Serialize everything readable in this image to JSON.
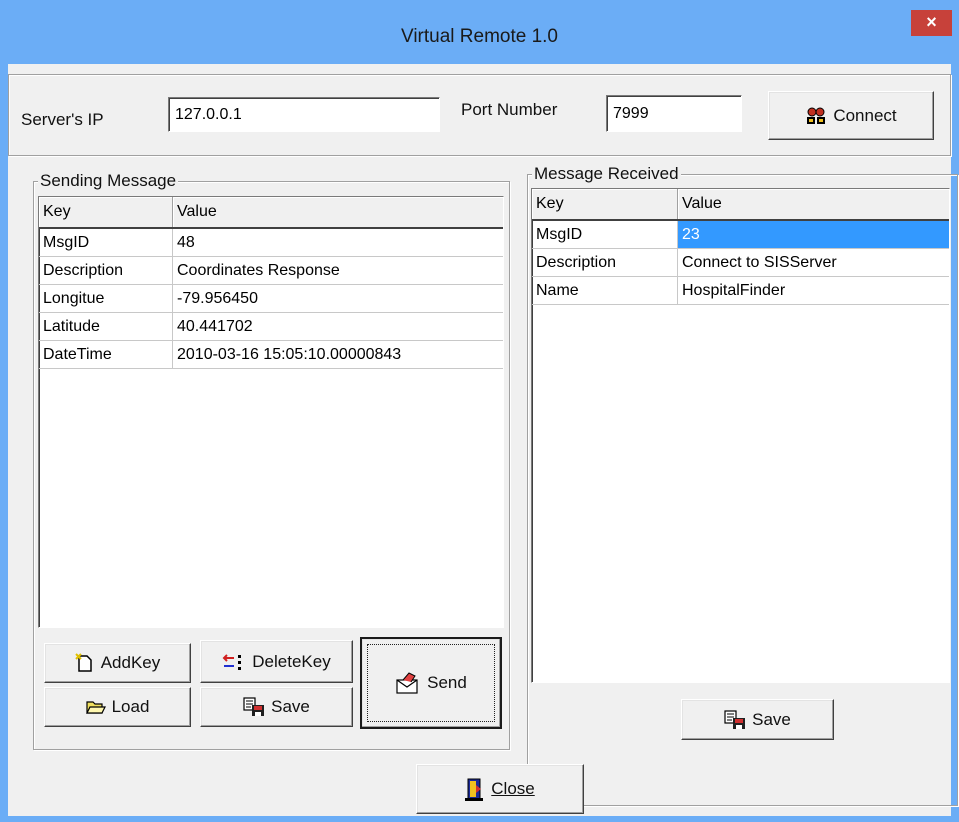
{
  "window": {
    "title": "Virtual Remote 1.0",
    "close_glyph": "×"
  },
  "connection": {
    "server_ip_label": "Server's IP",
    "server_ip_value": "127.0.0.1",
    "port_label": "Port Number",
    "port_value": "7999",
    "connect_label": "Connect"
  },
  "sending": {
    "title": "Sending Message",
    "columns": [
      "Key",
      "Value"
    ],
    "rows": [
      [
        "MsgID",
        "48"
      ],
      [
        "Description",
        "Coordinates Response"
      ],
      [
        "Longitue",
        "-79.956450"
      ],
      [
        "Latitude",
        "40.441702"
      ],
      [
        "DateTime",
        "2010-03-16 15:05:10.00000843"
      ]
    ],
    "add_key_label": "AddKey",
    "delete_key_label": "DeleteKey",
    "load_label": "Load",
    "save_label": "Save",
    "send_label": "Send"
  },
  "received": {
    "title": "Message Received",
    "columns": [
      "Key",
      "Value"
    ],
    "rows": [
      [
        "MsgID",
        "23"
      ],
      [
        "Description",
        "Connect to SISServer"
      ],
      [
        "Name",
        "HospitalFinder"
      ]
    ],
    "selected_value_row": 0,
    "save_label": "Save"
  },
  "footer": {
    "close_label": "Close"
  },
  "colors": {
    "title_bar": "#6badf6",
    "close_button": "#c7413a",
    "selection": "#3399ff"
  },
  "icons": [
    "close-icon",
    "connect-icon",
    "add-key-icon",
    "delete-key-icon",
    "load-icon",
    "save-icon",
    "send-icon",
    "exit-door-icon"
  ]
}
